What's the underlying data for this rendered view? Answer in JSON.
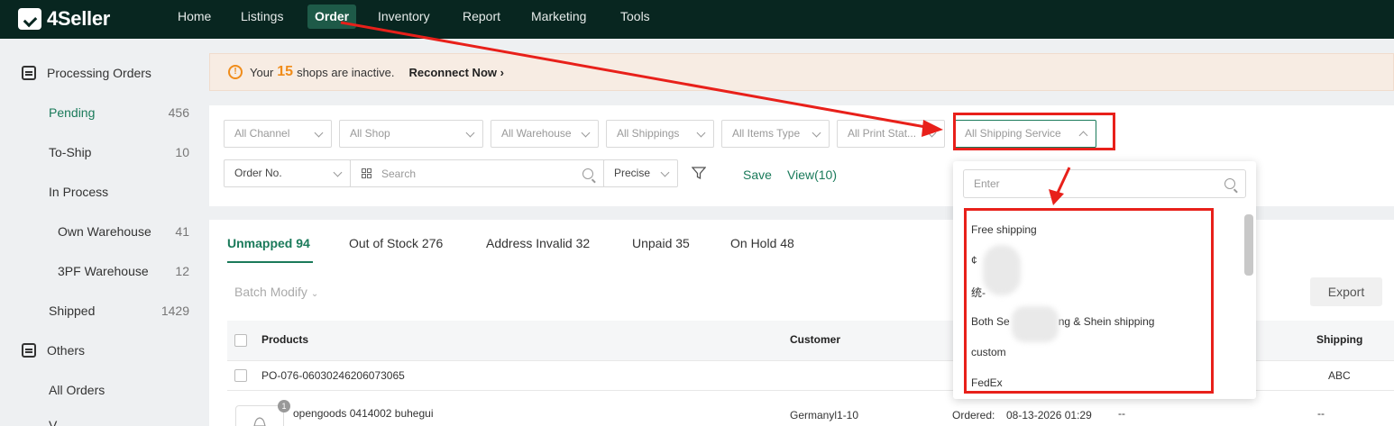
{
  "brand": {
    "name": "4Seller"
  },
  "nav": {
    "items": [
      "Home",
      "Listings",
      "Order",
      "Inventory",
      "Report",
      "Marketing",
      "Tools"
    ],
    "active": "Order"
  },
  "sidebar": {
    "section1": "Processing Orders",
    "items": [
      {
        "label": "Pending",
        "count": "456"
      },
      {
        "label": "To-Ship",
        "count": "10"
      },
      {
        "label": "In Process",
        "count": ""
      },
      {
        "label": "Own Warehouse",
        "count": "41"
      },
      {
        "label": "3PF Warehouse",
        "count": "12"
      },
      {
        "label": "Shipped",
        "count": "1429"
      }
    ],
    "section2": "Others",
    "all_orders": "All Orders",
    "partial": "V..."
  },
  "banner": {
    "prefix": "Your",
    "count": "15",
    "suffix": "shops are inactive.",
    "action": "Reconnect Now",
    "action_arrow": "›"
  },
  "filters": {
    "channel": "All Channel",
    "shop": "All Shop",
    "warehouse": "All Warehouse",
    "shippings": "All Shippings",
    "items_type": "All Items Type",
    "print_status": "All Print Stat...",
    "shipping_service": "All Shipping Service",
    "order_no": "Order No.",
    "search_placeholder": "Search",
    "precise": "Precise",
    "save": "Save",
    "view": "View(10)"
  },
  "dropdown": {
    "placeholder": "Enter",
    "options": [
      "Free shipping",
      "¢",
      "统-",
      "Both Se",
      "ng & Shein shipping",
      "custom",
      "FedEx"
    ]
  },
  "tabs": [
    {
      "label": "Unmapped 94"
    },
    {
      "label": "Out of Stock 276"
    },
    {
      "label": "Address Invalid 32"
    },
    {
      "label": "Unpaid 35"
    },
    {
      "label": "On Hold 48"
    }
  ],
  "toolbar": {
    "batch_modify": "Batch Modify",
    "export": "Export"
  },
  "table": {
    "headers": {
      "products": "Products",
      "customer": "Customer",
      "shipping": "Shipping"
    },
    "row1": {
      "po": "PO-076-06030246206073065",
      "shipping": "ABC"
    },
    "row2": {
      "product": "opengoods 0414002 buhegui",
      "badge": "1",
      "customer": "Germanyl1-10",
      "ordered_label": "Ordered:",
      "ordered_date": "08-13-2026 01:29",
      "dash1": "--",
      "dash2": "--"
    }
  },
  "colors": {
    "nav_bg": "#082620",
    "accent": "#1a7a5a",
    "warning": "#f08c1a",
    "annotation": "#e8201a"
  }
}
